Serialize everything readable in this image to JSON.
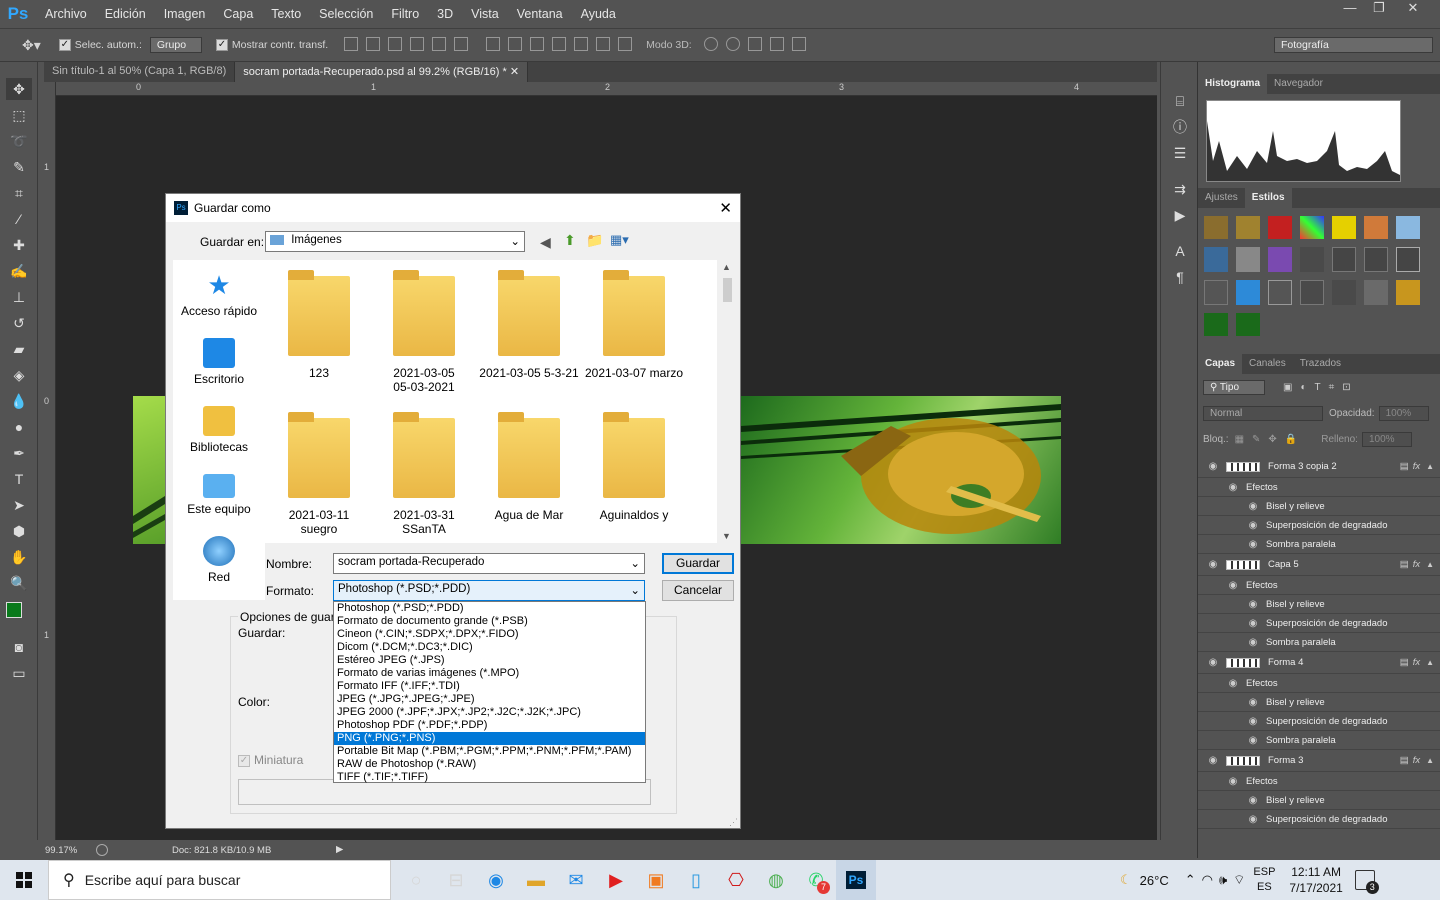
{
  "app": {
    "logo": "Ps"
  },
  "menu": [
    "Archivo",
    "Edición",
    "Imagen",
    "Capa",
    "Texto",
    "Selección",
    "Filtro",
    "3D",
    "Vista",
    "Ventana",
    "Ayuda"
  ],
  "options": {
    "auto_select_label": "Selec. autom.:",
    "auto_select_value": "Grupo",
    "transform_label": "Mostrar contr. transf.",
    "mode3d_label": "Modo 3D:",
    "workspace": "Fotografía"
  },
  "tabs": [
    {
      "label": "Sin título-1 al 50% (Capa 1, RGB/8)"
    },
    {
      "label": "socram portada-Recuperado.psd al 99.2% (RGB/16) *"
    }
  ],
  "ruler": {
    "top": [
      "0",
      "1",
      "2",
      "3",
      "4"
    ],
    "left": [
      "1",
      "0",
      "1"
    ]
  },
  "status": {
    "zoom": "99.17%",
    "doc": "Doc: 821.8 KB/10.9 MB"
  },
  "panels": {
    "histogram_tabs": [
      "Histograma",
      "Navegador"
    ],
    "styles_tabs": [
      "Ajustes",
      "Estilos"
    ],
    "layers_tabs": [
      "Capas",
      "Canales",
      "Trazados"
    ],
    "filter_label": "Tipo",
    "blend_mode": "Normal",
    "opacity_label": "Opacidad:",
    "opacity_value": "100%",
    "lock_label": "Bloq.:",
    "fill_label": "Relleno:",
    "fill_value": "100%",
    "layers": [
      {
        "name": "Forma 3 copia 2",
        "effects": [
          "Efectos",
          "Bisel y relieve",
          "Superposición de degradado",
          "Sombra paralela"
        ]
      },
      {
        "name": "Capa 5",
        "effects": [
          "Efectos",
          "Bisel y relieve",
          "Superposición de degradado",
          "Sombra paralela"
        ]
      },
      {
        "name": "Forma 4",
        "effects": [
          "Efectos",
          "Bisel y relieve",
          "Superposición de degradado",
          "Sombra paralela"
        ]
      },
      {
        "name": "Forma 3",
        "effects": [
          "Efectos",
          "Bisel y relieve",
          "Superposición de degradado"
        ]
      }
    ]
  },
  "dialog": {
    "title": "Guardar como",
    "save_in_label": "Guardar en:",
    "save_in_value": "Imágenes",
    "places": [
      "Acceso rápido",
      "Escritorio",
      "Bibliotecas",
      "Este equipo",
      "Red"
    ],
    "files": [
      {
        "name": "123",
        "name2": ""
      },
      {
        "name": "2021-03-05",
        "name2": "05-03-2021"
      },
      {
        "name": "2021-03-05 5-3-21",
        "name2": ""
      },
      {
        "name": "2021-03-07 marzo",
        "name2": ""
      },
      {
        "name": "2021-03-11 suegro",
        "name2": ""
      },
      {
        "name": "2021-03-31 SSanTA",
        "name2": ""
      },
      {
        "name": "Agua de Mar",
        "name2": ""
      },
      {
        "name": "Aguinaldos y",
        "name2": ""
      }
    ],
    "name_label": "Nombre:",
    "name_value": "socram portada-Recuperado",
    "format_label": "Formato:",
    "format_value": "Photoshop (*.PSD;*.PDD)",
    "save_button": "Guardar",
    "cancel_button": "Cancelar",
    "options_label": "Opciones de guar",
    "save_sub_label": "Guardar:",
    "color_label": "Color:",
    "thumbnail_label": "Miniatura",
    "formats": [
      "Photoshop (*.PSD;*.PDD)",
      "Formato de documento grande (*.PSB)",
      "Cineon (*.CIN;*.SDPX;*.DPX;*.FIDO)",
      "Dicom (*.DCM;*.DC3;*.DIC)",
      "Estéreo JPEG (*.JPS)",
      "Formato de varias imágenes (*.MPO)",
      "Formato IFF (*.IFF;*.TDI)",
      "JPEG (*.JPG;*.JPEG;*.JPE)",
      "JPEG 2000 (*.JPF;*.JPX;*.JP2;*.J2C;*.J2K;*.JPC)",
      "Photoshop PDF (*.PDF;*.PDP)",
      "PNG (*.PNG;*.PNS)",
      "Portable Bit Map (*.PBM;*.PGM;*.PPM;*.PNM;*.PFM;*.PAM)",
      "RAW de Photoshop (*.RAW)",
      "TIFF (*.TIF;*.TIFF)"
    ],
    "selected_format_index": 10
  },
  "taskbar": {
    "search_placeholder": "Escribe aquí para buscar",
    "weather": "26°C",
    "lang1": "ESP",
    "lang2": "ES",
    "time": "12:11 AM",
    "date": "7/17/2021",
    "notifications": "3",
    "badge_count": "7"
  }
}
